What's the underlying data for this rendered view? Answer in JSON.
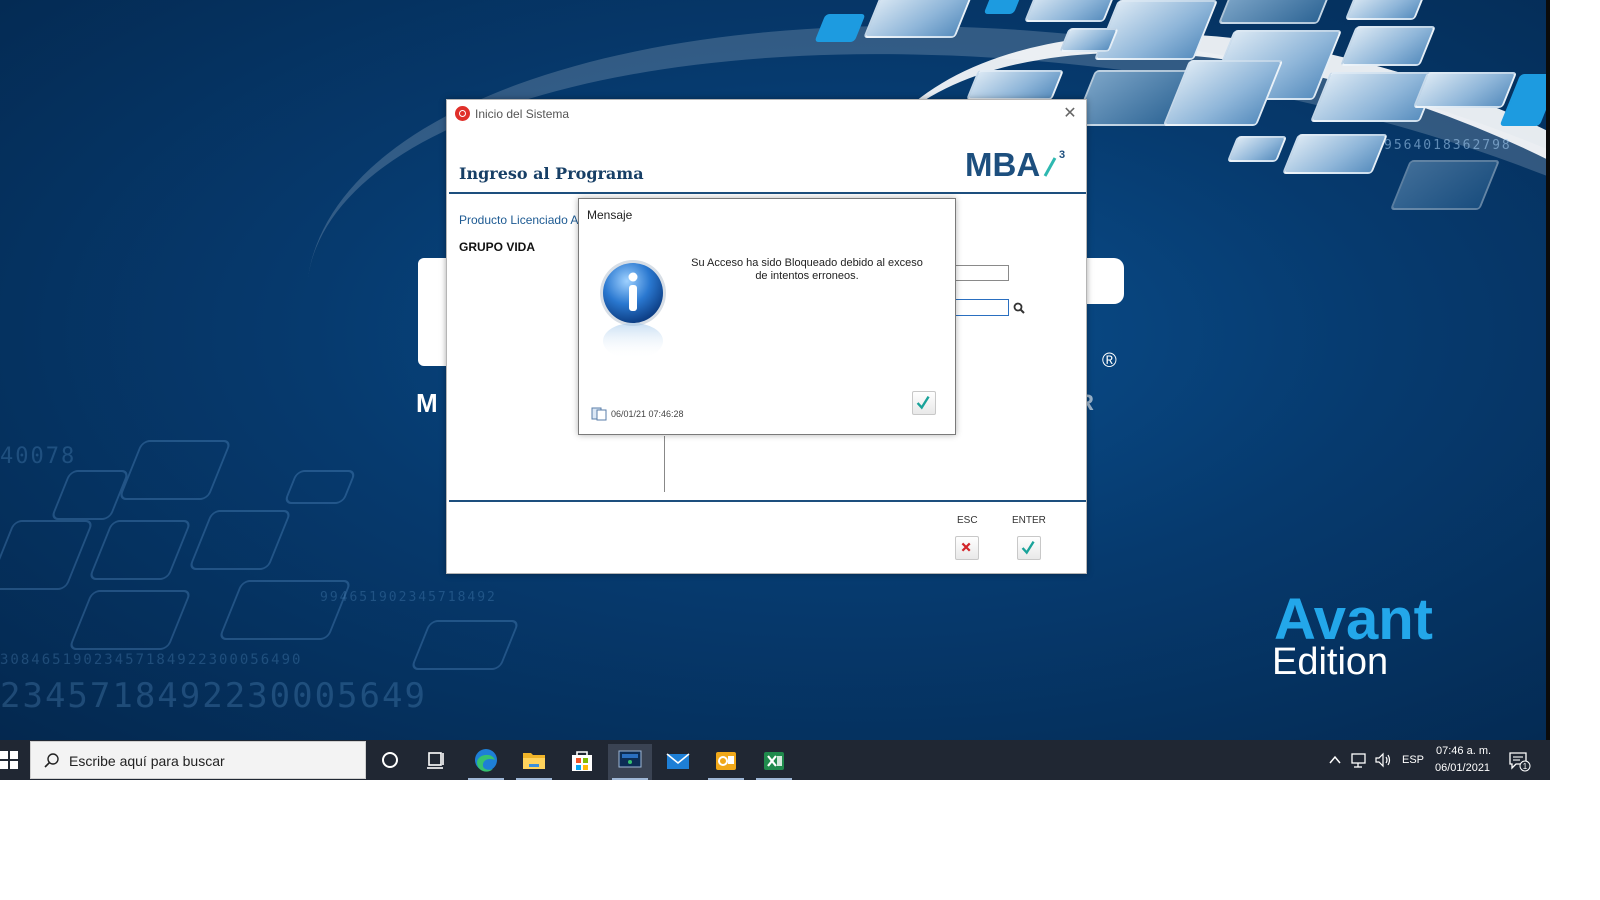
{
  "login_window": {
    "title": "Inicio del Sistema",
    "heading": "Ingreso al Programa",
    "product_label": "Producto Licenciado A",
    "company": "GRUPO VIDA",
    "logo_text": "MBA",
    "logo_superscript": "3",
    "esc_label": "ESC",
    "enter_label": "ENTER"
  },
  "message_dialog": {
    "title": "Mensaje",
    "message": "Su Acceso ha sido Bloqueado debido al exceso de intentos erroneos.",
    "timestamp": "06/01/21 07:46:28"
  },
  "background": {
    "brand_line1": "Avant",
    "brand_line2": "Edition",
    "bg_logo_m": "M",
    "bg_logo_r": "R",
    "bg_registered": "®"
  },
  "taskbar": {
    "search_placeholder": "Escribe aquí para buscar",
    "language": "ESP",
    "time": "07:46 a. m.",
    "date": "06/01/2021",
    "notification_count": "1"
  },
  "colors": {
    "desktop_blue": "#063a6e",
    "accent_navy": "#1d4f7e",
    "brand_cyan": "#23a7ea",
    "taskbar": "#202733"
  }
}
